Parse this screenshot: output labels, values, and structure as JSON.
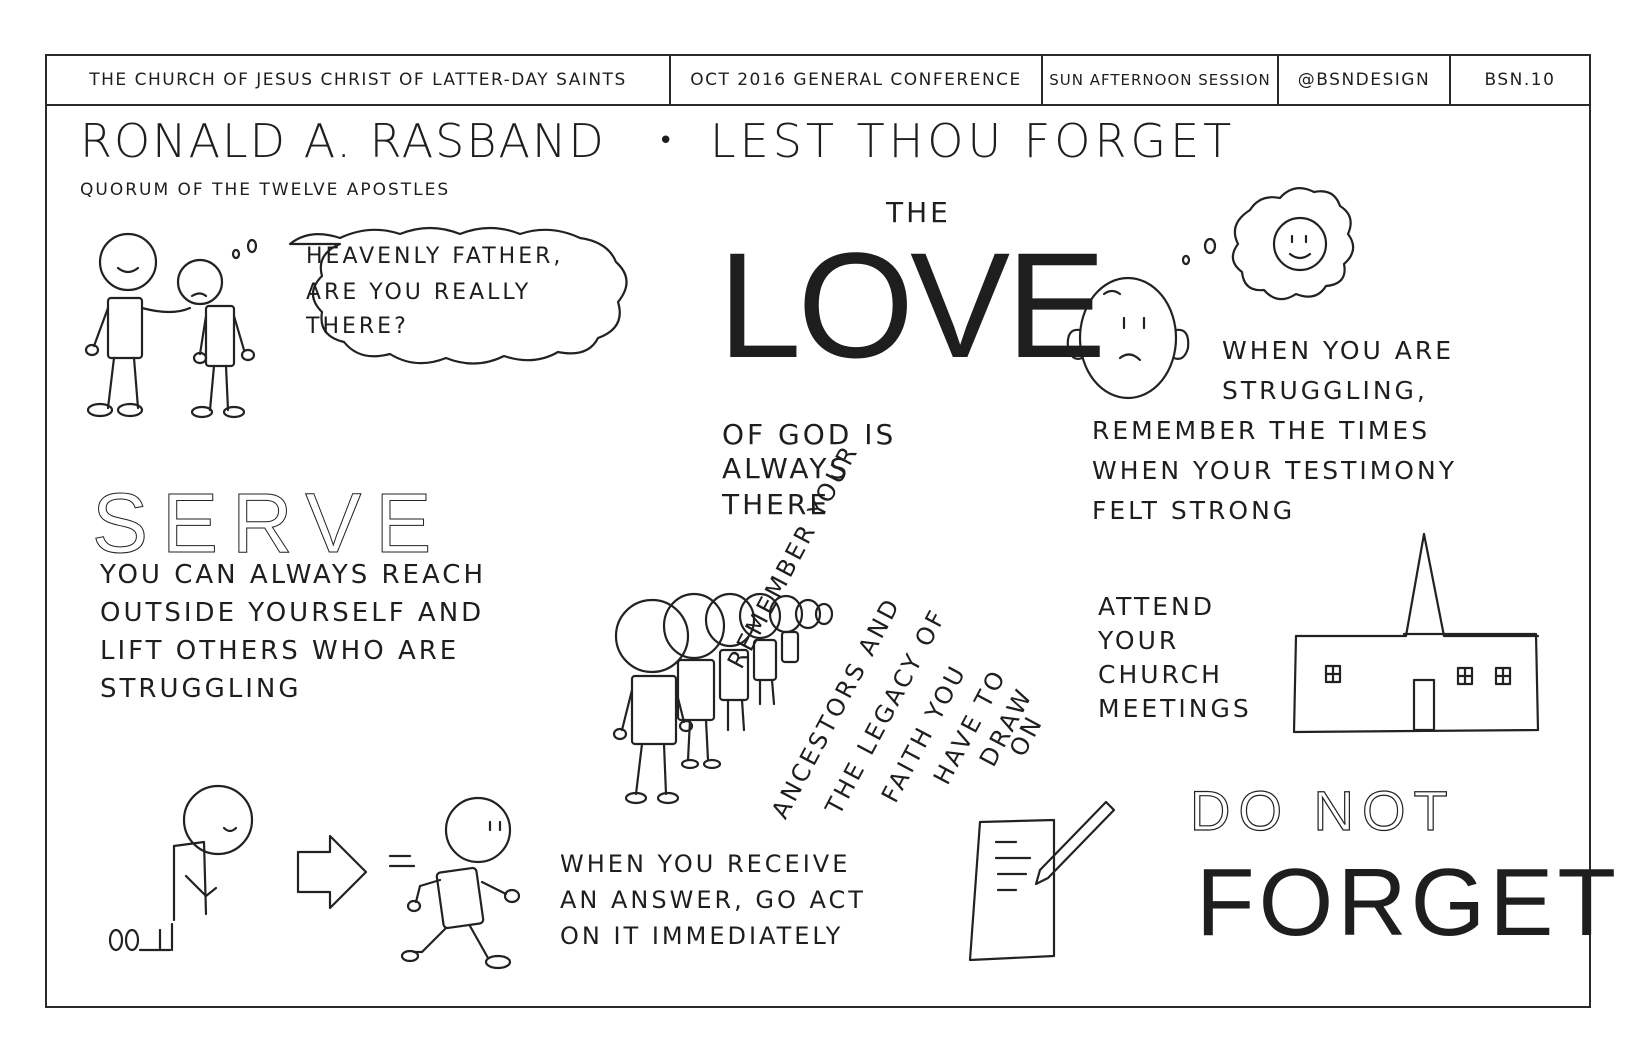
{
  "header": {
    "org": "THE CHURCH OF JESUS CHRIST OF LATTER-DAY SAINTS",
    "event": "OCT 2016 GENERAL CONFERENCE",
    "session": "SUN AFTERNOON SESSION",
    "handle": "@BSNDESIGN",
    "code": "BSN.10"
  },
  "talk": {
    "speaker": "RONALD A. RASBAND",
    "title": "LEST THOU FORGET",
    "calling": "QUORUM OF THE TWELVE APOSTLES"
  },
  "bubble": {
    "line1": "HEAVENLY FATHER,",
    "line2": "ARE YOU REALLY",
    "line3": "THERE?"
  },
  "love": {
    "the": "THE",
    "big": "LOVE",
    "line1": "OF GOD IS",
    "line2": "ALWAYS",
    "line3": "THERE"
  },
  "struggling": {
    "line1": "WHEN YOU ARE",
    "line2": "STRUGGLING,",
    "line3": "REMEMBER THE TIMES",
    "line4": "WHEN YOUR TESTIMONY",
    "line5": "FELT STRONG"
  },
  "serve": {
    "big": "SERVE",
    "line1": "YOU CAN ALWAYS REACH",
    "line2": "OUTSIDE YOURSELF AND",
    "line3": "LIFT OTHERS WHO ARE",
    "line4": "STRUGGLING"
  },
  "ancestors": {
    "line1": "REMEMBER YOUR",
    "line2": "ANCESTORS AND",
    "line3": "THE LEGACY OF",
    "line4": "FAITH YOU",
    "line5": "HAVE TO",
    "line6": "DRAW",
    "line7": "ON"
  },
  "attend": {
    "line1": "ATTEND",
    "line2": "YOUR",
    "line3": "CHURCH",
    "line4": "MEETINGS"
  },
  "answer": {
    "line1": "WHEN YOU RECEIVE",
    "line2": "AN ANSWER, GO ACT",
    "line3": "ON IT IMMEDIATELY"
  },
  "forget": {
    "line1": "DO NOT",
    "line2": "FORGET"
  }
}
